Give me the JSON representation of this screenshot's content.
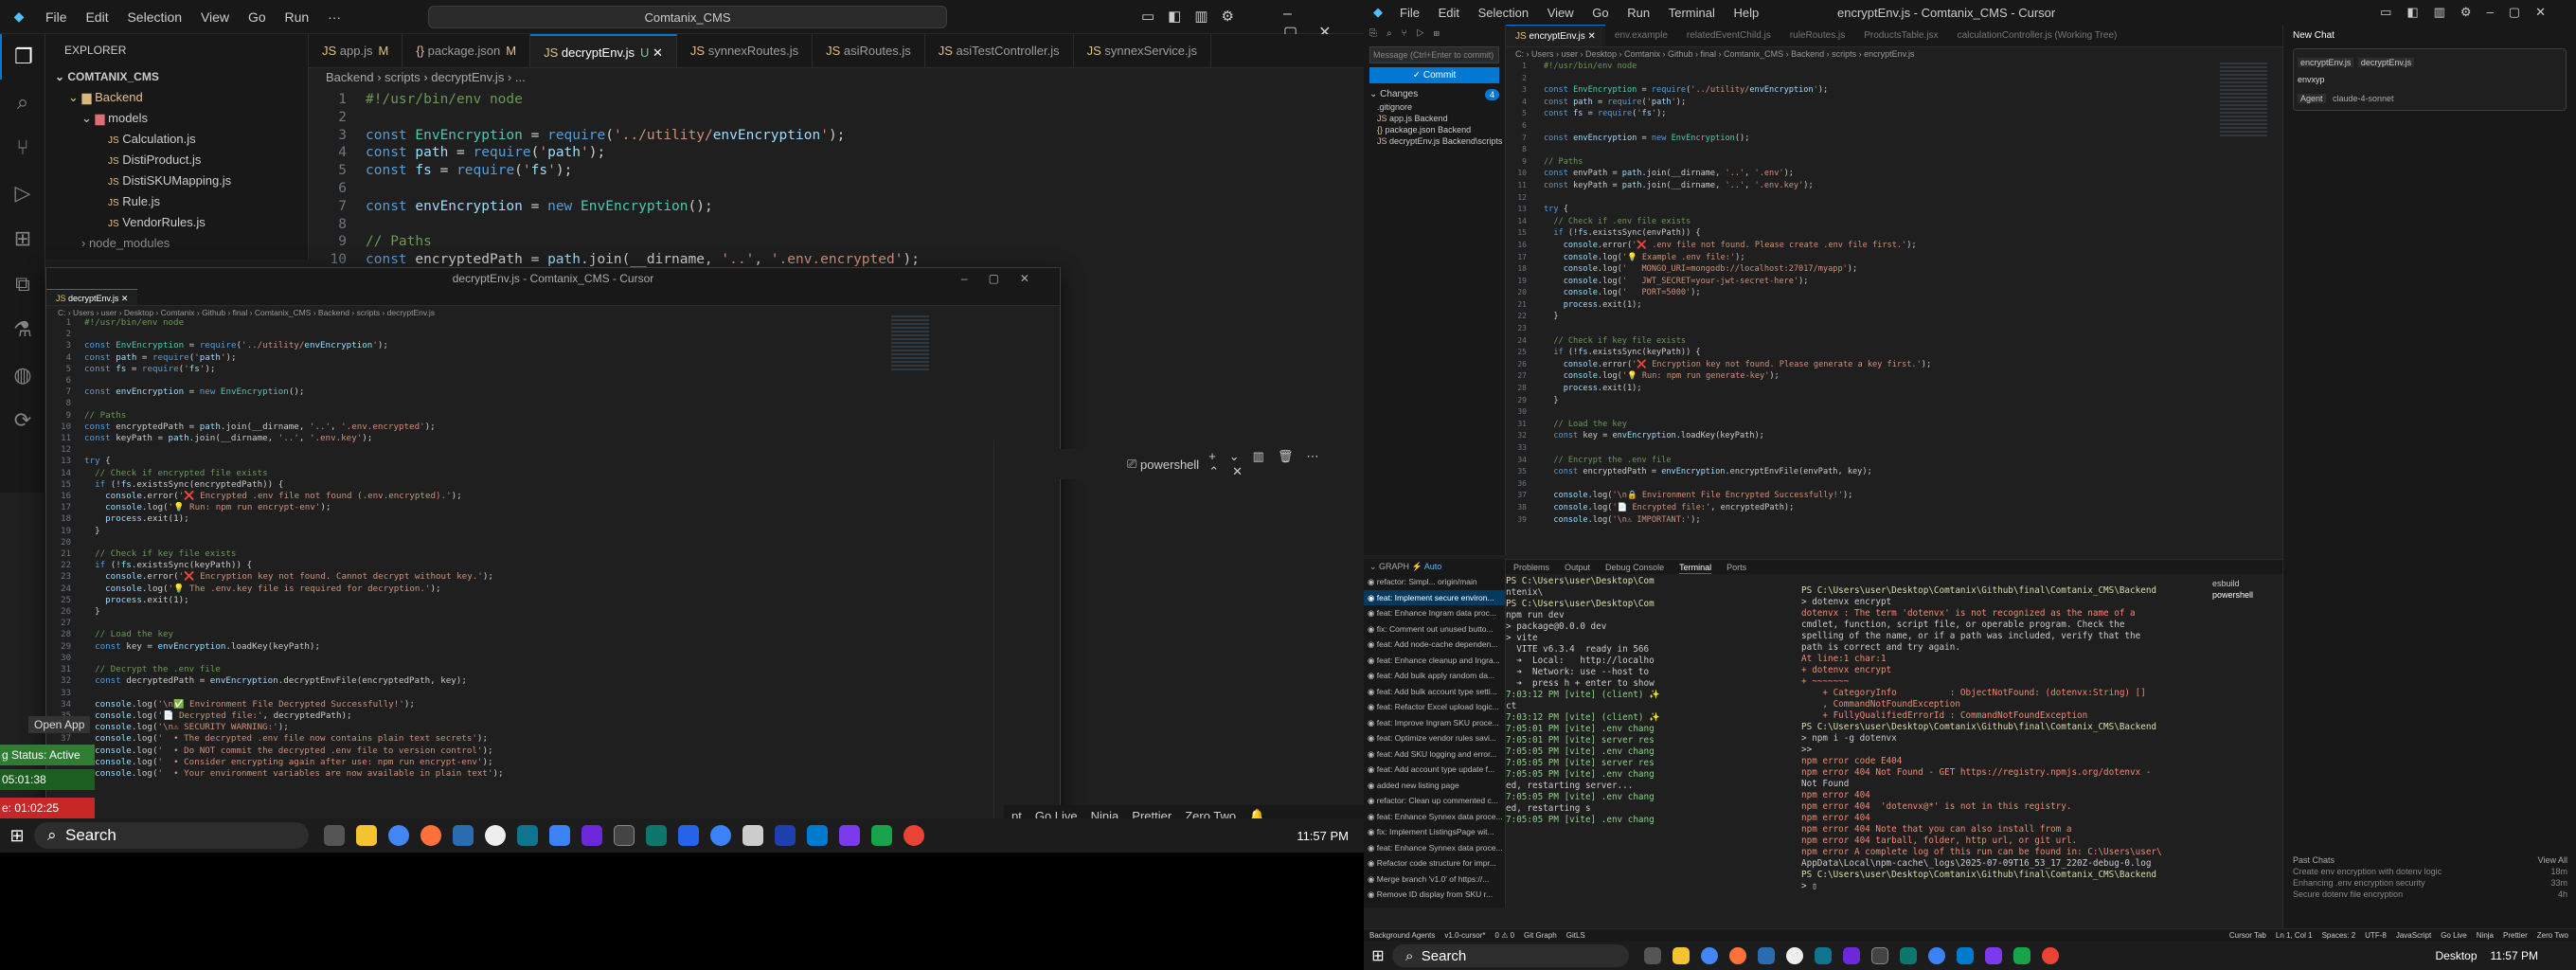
{
  "left": {
    "menu": [
      "File",
      "Edit",
      "Selection",
      "View",
      "Go",
      "Run",
      "···"
    ],
    "search": "Comtanix_CMS",
    "explorer": {
      "title": "EXPLORER",
      "root": "COMTANIX_CMS",
      "folder": "Backend",
      "models": "models",
      "files": [
        "Calculation.js",
        "DistiProduct.js",
        "DistiSKUMapping.js",
        "Rule.js",
        "VendorRules.js"
      ],
      "node_modules": "node_modules"
    },
    "tabs": [
      {
        "label": "app.js",
        "mod": "M"
      },
      {
        "label": "package.json",
        "mod": "M"
      },
      {
        "label": "decryptEnv.js",
        "mod": "U"
      },
      {
        "label": "synnexRoutes.js",
        "mod": ""
      },
      {
        "label": "asiRoutes.js",
        "mod": ""
      },
      {
        "label": "asiTestController.js",
        "mod": ""
      },
      {
        "label": "synnexService.js",
        "mod": ""
      }
    ],
    "breadcrumb": "Backend › scripts › decryptEnv.js › ...",
    "code": [
      "#!/usr/bin/env node",
      "",
      "const EnvEncryption = require('../utility/envEncryption');",
      "const path = require('path');",
      "const fs = require('fs');",
      "",
      "const envEncryption = new EnvEncryption();",
      "",
      "// Paths",
      "const encryptedPath = path.join(__dirname, '..', '.env.encrypted');"
    ],
    "status_items": [
      "Go Live",
      "Ninja",
      "Prettier",
      "Zero Two"
    ],
    "open_app": "Open App",
    "left_badges": [
      "g Status: Active",
      "05:01:38",
      "e: 01:02:25"
    ],
    "taskbar_search": "Search",
    "time": "11:57 PM"
  },
  "float": {
    "title": "decryptEnv.js - Comtanix_CMS - Cursor",
    "tab": "decryptEnv.js",
    "breadcrumb": "C: › Users › user › Desktop › Comtanix › Github › final › Comtanix_CMS › Backend › scripts › decryptEnv.js",
    "code": [
      "#!/usr/bin/env node",
      "",
      "const EnvEncryption = require('../utility/envEncryption');",
      "const path = require('path');",
      "const fs = require('fs');",
      "",
      "const envEncryption = new EnvEncryption();",
      "",
      "// Paths",
      "const encryptedPath = path.join(__dirname, '..', '.env.encrypted');",
      "const keyPath = path.join(__dirname, '..', '.env.key');",
      "",
      "try {",
      "  // Check if encrypted file exists",
      "  if (!fs.existsSync(encryptedPath)) {",
      "    console.error('❌ Encrypted .env file not found (.env.encrypted).');",
      "    console.log('💡 Run: npm run encrypt-env');",
      "    process.exit(1);",
      "  }",
      "",
      "  // Check if key file exists",
      "  if (!fs.existsSync(keyPath)) {",
      "    console.error('❌ Encryption key not found. Cannot decrypt without key.');",
      "    console.log('💡 The .env.key file is required for decryption.');",
      "    process.exit(1);",
      "  }",
      "",
      "  // Load the key",
      "  const key = envEncryption.loadKey(keyPath);",
      "",
      "  // Decrypt the .env file",
      "  const decryptedPath = envEncryption.decryptEnvFile(encryptedPath, key);",
      "",
      "  console.log('\\n✅ Environment File Decrypted Successfully!');",
      "  console.log('📄 Decrypted file:', decryptedPath);",
      "  console.log('\\n⚠ SECURITY WARNING:');",
      "  console.log('  • The decrypted .env file now contains plain text secrets');",
      "  console.log('  • Do NOT commit the decrypted .env file to version control');",
      "  console.log('  • Consider encrypting again after use: npm run encrypt-env');",
      "  console.log('  • Your environment variables are now available in plain text');"
    ],
    "terminal": "powershell"
  },
  "right": {
    "menu": [
      "File",
      "Edit",
      "Selection",
      "View",
      "Go",
      "Run",
      "Terminal",
      "Help"
    ],
    "title": "encryptEnv.js - Comtanix_CMS - Cursor",
    "tabs": [
      "encryptEnv.js",
      "env.example",
      "relatedEventChild.js",
      "ruleRoutes.js",
      "ProductsTable.jsx",
      "calculationController.js (Working Tree)"
    ],
    "breadcrumb": "C: › Users › user › Desktop › Comtanix › Github › final › Comtanix_CMS › Backend › scripts › encryptEnv.js",
    "scm": {
      "message_placeholder": "Message (Ctrl+Enter to commit)",
      "commit": "✓ Commit",
      "changes": "Changes",
      "files": [
        ".gitignore",
        "app.js Backend",
        "package.json Backend",
        "decryptEnv.js Backend\\scripts"
      ]
    },
    "code": [
      "#!/usr/bin/env node",
      "",
      "const EnvEncryption = require('../utility/envEncryption');",
      "const path = require('path');",
      "const fs = require('fs');",
      "",
      "const envEncryption = new EnvEncryption();",
      "",
      "// Paths",
      "const envPath = path.join(__dirname, '..', '.env');",
      "const keyPath = path.join(__dirname, '..', '.env.key');",
      "",
      "try {",
      "  // Check if .env file exists",
      "  if (!fs.existsSync(envPath)) {",
      "    console.error('❌ .env file not found. Please create .env file first.');",
      "    console.log('💡 Example .env file:');",
      "    console.log('   MONGO_URI=mongodb://localhost:27017/myapp');",
      "    console.log('   JWT_SECRET=your-jwt-secret-here');",
      "    console.log('   PORT=5000');",
      "    process.exit(1);",
      "  }",
      "",
      "  // Check if key file exists",
      "  if (!fs.existsSync(keyPath)) {",
      "    console.error('❌ Encryption key not found. Please generate a key first.');",
      "    console.log('💡 Run: npm run generate-key');",
      "    process.exit(1);",
      "  }",
      "",
      "  // Load the key",
      "  const key = envEncryption.loadKey(keyPath);",
      "",
      "  // Encrypt the .env file",
      "  const encryptedPath = envEncryption.encryptEnvFile(envPath, key);",
      "",
      "  console.log('\\n🔒 Environment File Encrypted Successfully!');",
      "  console.log('📄 Encrypted file:', encryptedPath);",
      "  console.log('\\n⚠ IMPORTANT:');"
    ],
    "graph": [
      "refactor: Simpl... origin/main",
      "feat: Implement secure environ...",
      "feat: Enhance Ingram data proc...",
      "fix: Comment out unused butto...",
      "feat: Add node-cache dependen...",
      "feat: Enhance cleanup and Ingra...",
      "feat: Add bulk apply random da...",
      "feat: Add bulk account type setti...",
      "feat: Refactor Excel upload logic...",
      "feat: Improve Ingram SKU proce...",
      "feat: Optimize vendor rules savi...",
      "feat: Add SKU logging and error...",
      "feat: Add account type update f...",
      "added new listing page",
      "refactor: Clean up commented c...",
      "feat: Enhance Synnex data proce...",
      "fix: Implement ListingsPage wit...",
      "feat: Enhance Synnex data proce...",
      "Refactor code structure for impr...",
      "Merge branch 'v1.0' of https://...",
      "Remove ID display from SKU r..."
    ],
    "panel_tabs": [
      "Problems",
      "Output",
      "Debug Console",
      "Terminal",
      "Ports"
    ],
    "term1": [
      "PS C:\\Users\\user\\Desktop\\Com",
      "ntenix\\",
      "PS C:\\Users\\user\\Desktop\\Com",
      "npm run dev",
      "",
      "> package@0.0.0 dev",
      "> vite",
      "",
      "  VITE v6.3.4  ready in 566",
      "",
      "  ➜  Local:   http://localho",
      "  ➜  Network: use --host to",
      "  ➜  press h + enter to show",
      "7:03:12 PM [vite] (client) ✨",
      "ct",
      "7:03:12 PM [vite] (client) ✨",
      "7:05:01 PM [vite] .env chang",
      "7:05:01 PM [vite] server res",
      "7:05:05 PM [vite] .env chang",
      "7:05:05 PM [vite] server res",
      "7:05:05 PM [vite] .env chang",
      "ed, restarting server...",
      "7:05:05 PM [vite] .env chang",
      "ed, restarting s",
      "7:05:05 PM [vite] .env chang"
    ],
    "term2": [
      "PS C:\\Users\\user\\Desktop\\Comtanix\\Github\\final\\Comtanix_CMS\\Backend",
      "> dotenvx encrypt",
      "dotenvx : The term 'dotenvx' is not recognized as the name of a",
      "cmdlet, function, script file, or operable program. Check the",
      "spelling of the name, or if a path was included, verify that the",
      "path is correct and try again.",
      "At line:1 char:1",
      "+ dotenvx encrypt",
      "+ ~~~~~~~",
      "    + CategoryInfo          : ObjectNotFound: (dotenvx:String) []",
      "    , CommandNotFoundException",
      "    + FullyQualifiedErrorId : CommandNotFoundException",
      "",
      "PS C:\\Users\\user\\Desktop\\Comtanix\\Github\\final\\Comtanix_CMS\\Backend",
      "> npm i -g dotenvx",
      ">>",
      "npm error code E404",
      "npm error 404 Not Found - GET https://registry.npmjs.org/dotenvx -",
      "Not Found",
      "npm error 404",
      "npm error 404  'dotenvx@*' is not in this registry.",
      "npm error 404",
      "npm error 404 Note that you can also install from a",
      "npm error 404 tarball, folder, http url, or git url.",
      "npm error A complete log of this run can be found in: C:\\Users\\user\\",
      "AppData\\Local\\npm-cache\\_logs\\2025-07-09T16_53_17_220Z-debug-0.log",
      "PS C:\\Users\\user\\Desktop\\Comtanix\\Github\\final\\Comtanix_CMS\\Backend",
      "> ▯"
    ],
    "term_list": [
      "esbuild",
      "powershell"
    ],
    "chat": {
      "title": "New Chat",
      "ctx1": "encryptEnv.js",
      "ctx2": "decryptEnv.js",
      "input": "envxyp",
      "agent": "Agent",
      "model": "claude-4-sonnet",
      "past": "Past Chats",
      "view_all": "View All",
      "items": [
        "Create env encryption with dotenv logic",
        "Enhancing .env encryption security",
        "Secure dotenv file encryption"
      ],
      "ages": [
        "18m",
        "33m",
        "4h"
      ]
    },
    "status": [
      "Background Agents",
      "v1.0-cursor*",
      "0 ⚠ 0",
      "Git Graph",
      "GitLS",
      "Cursor Tab",
      "Ln 1, Col 1",
      "Spaces: 2",
      "UTF-8",
      "JavaScript",
      "Go Live",
      "Ninja",
      "Prettier",
      "Zero Two"
    ],
    "taskbar_search": "Search",
    "desktop": "Desktop",
    "time": "11:57 PM"
  }
}
